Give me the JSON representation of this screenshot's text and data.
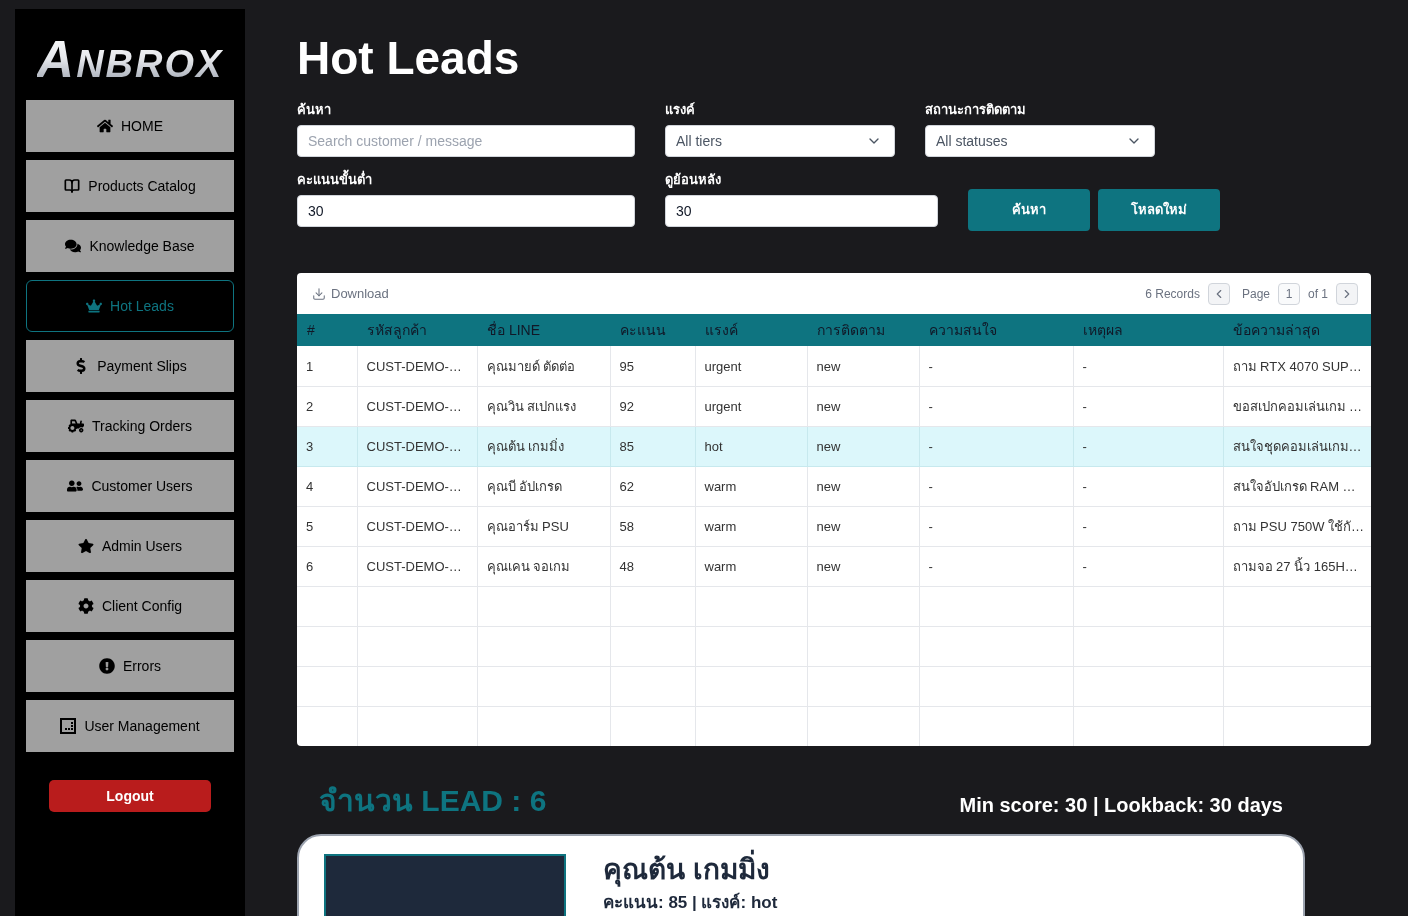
{
  "sidebar": {
    "logo": "ANBROX",
    "items": [
      {
        "label": "HOME",
        "selected": false
      },
      {
        "label": "Products Catalog",
        "selected": false
      },
      {
        "label": "Knowledge Base",
        "selected": false
      },
      {
        "label": "Hot Leads",
        "selected": true
      },
      {
        "label": "Payment Slips",
        "selected": false
      },
      {
        "label": "Tracking Orders",
        "selected": false
      },
      {
        "label": "Customer Users",
        "selected": false
      },
      {
        "label": "Admin Users",
        "selected": false
      },
      {
        "label": "Client Config",
        "selected": false
      },
      {
        "label": "Errors",
        "selected": false
      },
      {
        "label": "User Management",
        "selected": false
      }
    ],
    "logout": "Logout"
  },
  "title": "Hot Leads",
  "filters": [
    [
      {
        "kind": "text",
        "label": "ค้นหา",
        "placeholder": "Search customer / message"
      },
      {
        "kind": "select",
        "label": "แรงค์",
        "value": "All tiers"
      },
      {
        "kind": "select",
        "label": "สถานะการติดตาม",
        "value": "All statuses"
      }
    ],
    [
      {
        "kind": "text",
        "label": "คะแนนขั้นต่ำ",
        "value": "30"
      },
      {
        "kind": "text",
        "label": "ดูย้อนหลัง",
        "value": "30"
      }
    ]
  ],
  "buttons": [
    "ค้นหา",
    "โหลดใหม่"
  ],
  "table": {
    "toolbar": {
      "download": "Download",
      "records": "6 Records",
      "page_label": "Page",
      "page": "1",
      "page_total": "of 1"
    },
    "columns": [
      "#",
      "รหัสลูกค้า",
      "ชื่อ LINE",
      "คะแนน",
      "แรงค์",
      "การติดตาม",
      "ความสนใจ",
      "เหตุผล",
      "ข้อความล่าสุด"
    ],
    "rows": [
      {
        "selected": false,
        "cells": [
          "1",
          "CUST-DEMO-…",
          "คุณมายด์ ตัดต่อ",
          "95",
          "urgent",
          "new",
          "-",
          "-",
          "ถาม RTX 4070 SUP…"
        ]
      },
      {
        "selected": false,
        "cells": [
          "2",
          "CUST-DEMO-…",
          "คุณวิน สเปกแรง",
          "92",
          "urgent",
          "new",
          "-",
          "-",
          "ขอสเปกคอมเล่นเกม …"
        ]
      },
      {
        "selected": true,
        "cells": [
          "3",
          "CUST-DEMO-…",
          "คุณต้น เกมมิ่ง",
          "85",
          "hot",
          "new",
          "-",
          "-",
          "สนใจชุดคอมเล่นเกม…"
        ]
      },
      {
        "selected": false,
        "cells": [
          "4",
          "CUST-DEMO-…",
          "คุณบี อัปเกรด",
          "62",
          "warm",
          "new",
          "-",
          "-",
          "สนใจอัปเกรด RAM …"
        ]
      },
      {
        "selected": false,
        "cells": [
          "5",
          "CUST-DEMO-…",
          "คุณอาร์ม PSU",
          "58",
          "warm",
          "new",
          "-",
          "-",
          "ถาม PSU 750W ใช้กั…"
        ]
      },
      {
        "selected": false,
        "cells": [
          "6",
          "CUST-DEMO-…",
          "คุณเคน จอเกม",
          "48",
          "warm",
          "new",
          "-",
          "-",
          "ถามจอ 27 นิ้ว 165H…"
        ]
      }
    ]
  },
  "summary": {
    "count": "จำนวน LEAD : 6",
    "criteria": "Min score: 30 | Lookback: 30 days"
  },
  "lead_card": {
    "name": "คุณต้น เกมมิ่ง",
    "details": "คะแนน: 85 | แรงค์: hot"
  }
}
